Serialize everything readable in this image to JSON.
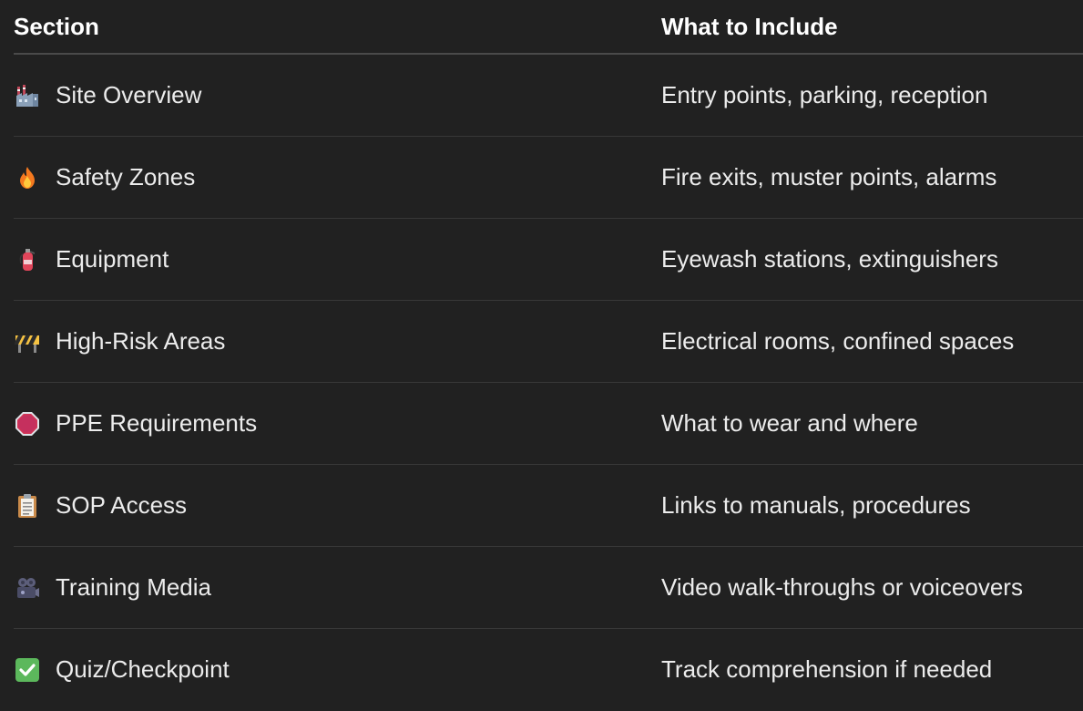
{
  "table": {
    "headers": {
      "section": "Section",
      "include": "What to Include"
    },
    "rows": [
      {
        "icon": "factory-icon",
        "section": "Site Overview",
        "include": "Entry points, parking, reception"
      },
      {
        "icon": "fire-icon",
        "section": "Safety Zones",
        "include": "Fire exits, muster points, alarms"
      },
      {
        "icon": "fire-extinguisher-icon",
        "section": "Equipment",
        "include": "Eyewash stations, extinguishers"
      },
      {
        "icon": "construction-barrier-icon",
        "section": "High-Risk Areas",
        "include": "Electrical rooms, confined spaces"
      },
      {
        "icon": "stop-sign-icon",
        "section": "PPE Requirements",
        "include": "What to wear and where"
      },
      {
        "icon": "clipboard-icon",
        "section": "SOP Access",
        "include": "Links to manuals, procedures"
      },
      {
        "icon": "movie-camera-icon",
        "section": "Training Media",
        "include": "Video walk-throughs or voiceovers"
      },
      {
        "icon": "check-mark-button-icon",
        "section": "Quiz/Checkpoint",
        "include": "Track comprehension if needed"
      }
    ]
  },
  "colors": {
    "background": "#212121",
    "text": "#ececec",
    "header_text": "#ffffff",
    "divider": "#383838"
  }
}
